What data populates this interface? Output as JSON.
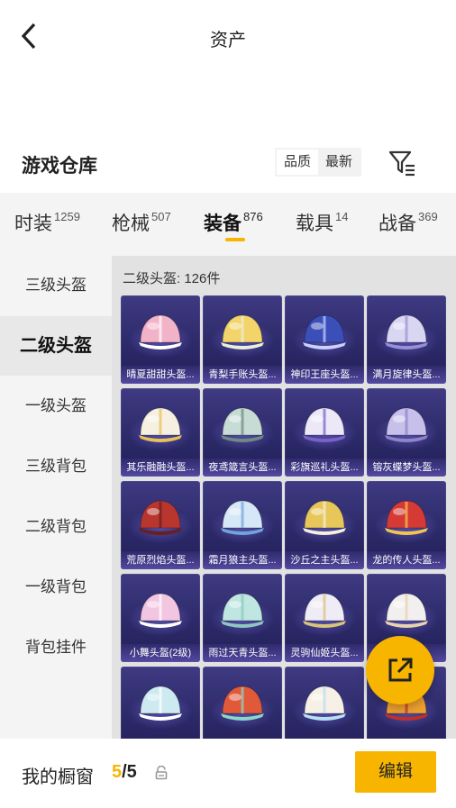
{
  "header": {
    "title": "资产"
  },
  "section": {
    "title": "游戏仓库",
    "sort_options": [
      "品质",
      "最新"
    ]
  },
  "tabs": [
    {
      "label": "时装",
      "count": "1259"
    },
    {
      "label": "枪械",
      "count": "507"
    },
    {
      "label": "装备",
      "count": "876"
    },
    {
      "label": "载具",
      "count": "14"
    },
    {
      "label": "战备",
      "count": "369"
    }
  ],
  "sidebar": {
    "items": [
      "三级头盔",
      "二级头盔",
      "一级头盔",
      "三级背包",
      "二级背包",
      "一级背包",
      "背包挂件"
    ]
  },
  "content": {
    "count_label": "二级头盔: 126件"
  },
  "items": [
    {
      "name": "晴夏甜甜头盔...",
      "color": "#f2b3c8",
      "accent": "#ffffff"
    },
    {
      "name": "青梨手账头盔...",
      "color": "#f2d46a",
      "accent": "#e8f0d8"
    },
    {
      "name": "神印王座头盔...",
      "color": "#3b4fb8",
      "accent": "#c9d1ff"
    },
    {
      "name": "满月旋律头盔...",
      "color": "#d9d6f2",
      "accent": "#9a8fd6"
    },
    {
      "name": "其乐融融头盔...",
      "color": "#f5f0e0",
      "accent": "#e8c15a"
    },
    {
      "name": "夜鸢箴言头盔...",
      "color": "#c8dcd6",
      "accent": "#6e8a84"
    },
    {
      "name": "彩旗巡礼头盔...",
      "color": "#ece8f7",
      "accent": "#7a62c9"
    },
    {
      "name": "镕灰蝶梦头盔...",
      "color": "#c7c0ea",
      "accent": "#8e84c8"
    },
    {
      "name": "荒原烈焰头盔...",
      "color": "#b8362e",
      "accent": "#6a1e1e"
    },
    {
      "name": "霜月狼主头盔...",
      "color": "#d6e8f7",
      "accent": "#6fa6d9"
    },
    {
      "name": "沙丘之主头盔...",
      "color": "#e8c75a",
      "accent": "#f5f0dc"
    },
    {
      "name": "龙的传人头盔...",
      "color": "#d63a34",
      "accent": "#f2c451"
    },
    {
      "name": "小舞头盔(2级)",
      "color": "#f2c6e0",
      "accent": "#ffffff"
    },
    {
      "name": "雨过天青头盔...",
      "color": "#bfe6e0",
      "accent": "#8fc7c0"
    },
    {
      "name": "灵驹仙姬头盔...",
      "color": "#f0ecf6",
      "accent": "#d8c47a"
    },
    {
      "name": "...",
      "color": "#f2f0ee",
      "accent": "#e8d2b0"
    },
    {
      "name": "",
      "color": "#cdeaf0",
      "accent": "#ffffff"
    },
    {
      "name": "",
      "color": "#e05a3a",
      "accent": "#8cd6c8"
    },
    {
      "name": "",
      "color": "#f7f0e6",
      "accent": "#b8e0f2"
    },
    {
      "name": "",
      "color": "#f0a030",
      "accent": "#c0302a"
    }
  ],
  "bottom": {
    "label": "我的橱窗",
    "current": "5",
    "total": "/5",
    "edit_label": "编辑"
  }
}
